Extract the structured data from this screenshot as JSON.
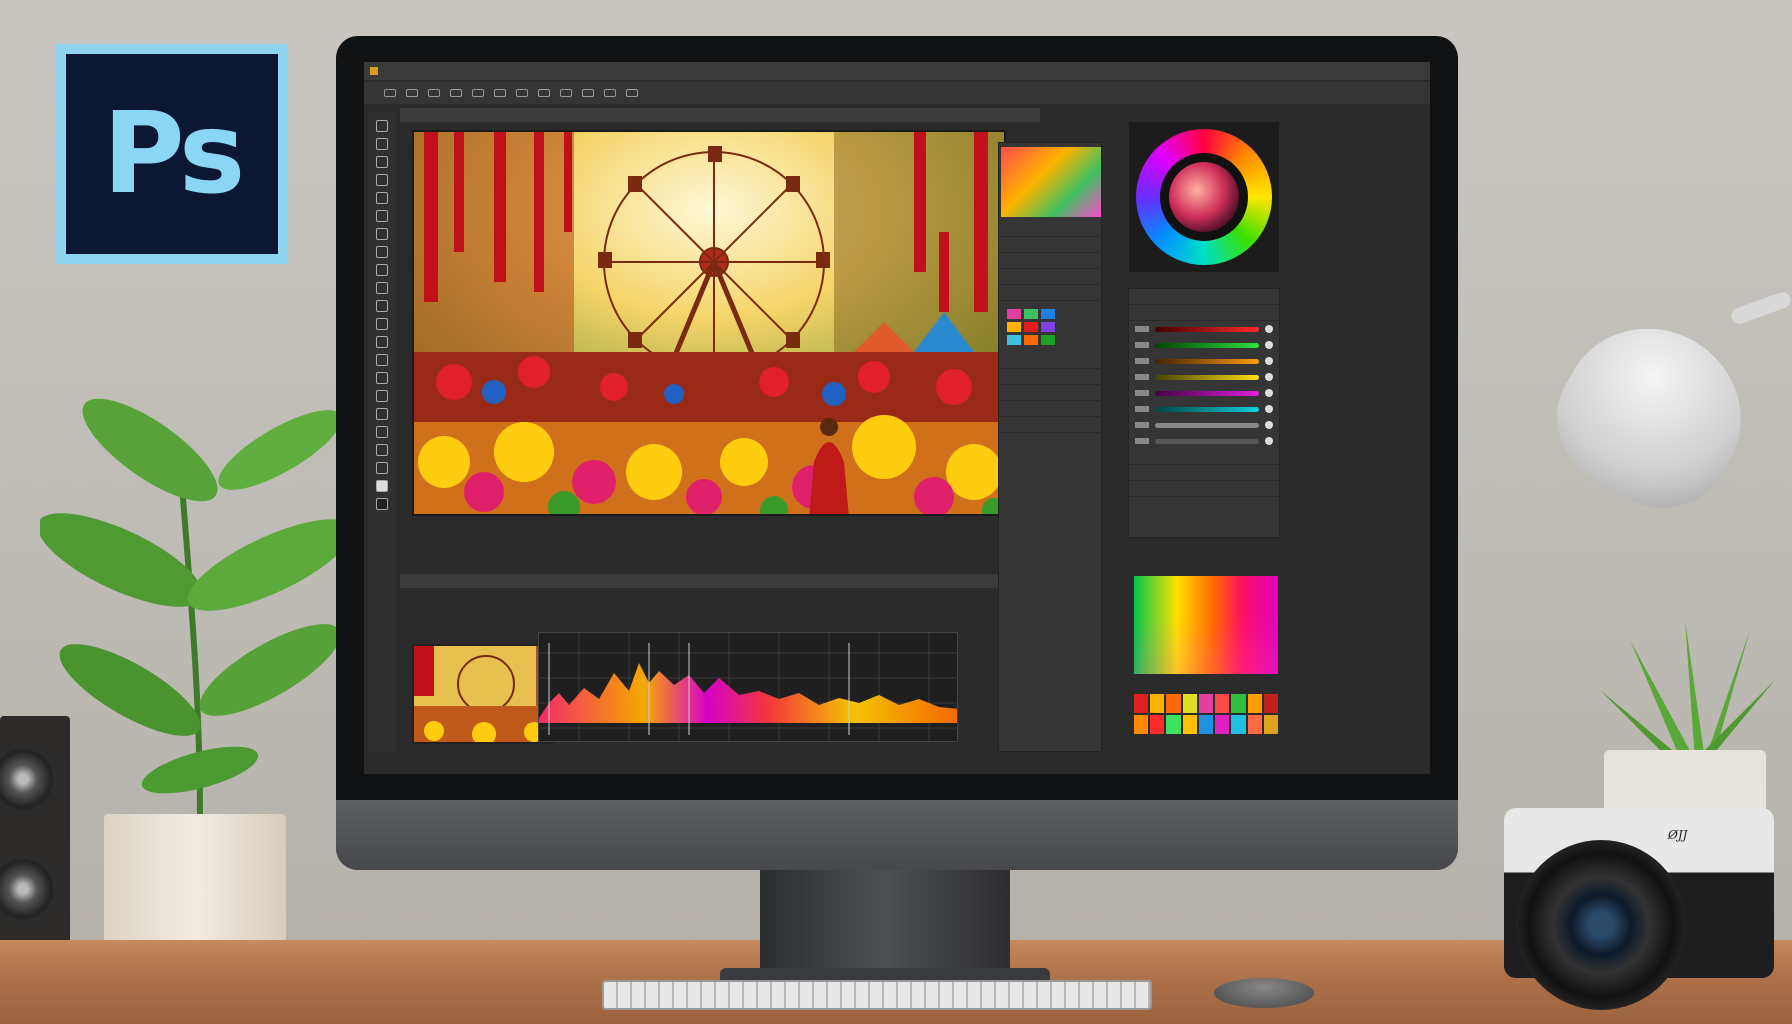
{
  "logo": {
    "text": "Ps"
  },
  "camera": {
    "brand": "Ø̸JJ"
  },
  "app": {
    "menu": [
      "",
      "",
      "",
      "",
      "",
      "",
      "",
      "",
      ""
    ],
    "document_tab": "",
    "layers_panel": {
      "rows": [
        "",
        "",
        "",
        "",
        "",
        "",
        "",
        "",
        "",
        ""
      ]
    },
    "adjustments_panel": {
      "rows": [
        "",
        "",
        "",
        "",
        "",
        ""
      ]
    }
  },
  "colors": {
    "ui_bg": "#2b2b2b",
    "panel_bg": "#353535",
    "accent_logo": "#8ad6f4",
    "logo_bg": "#0b1733"
  },
  "icons": [
    "ferris-wheel-icon",
    "color-wheel-icon"
  ]
}
